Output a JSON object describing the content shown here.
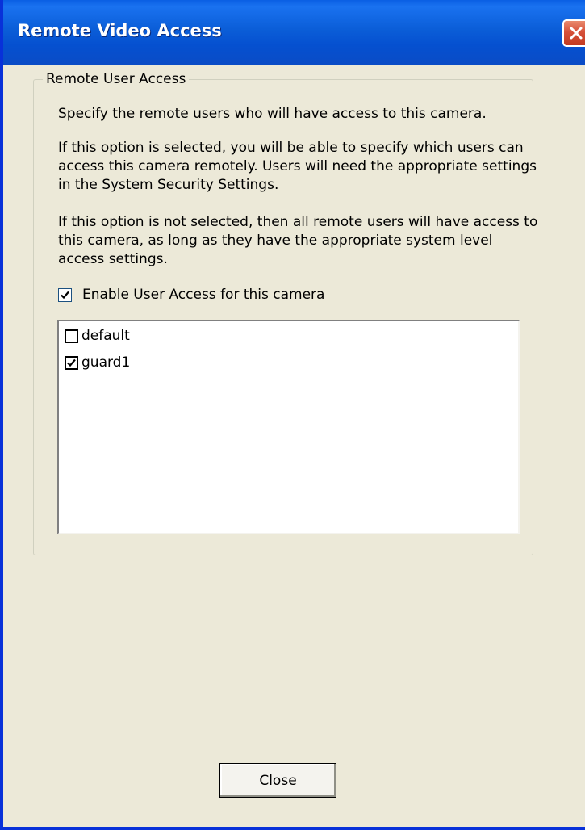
{
  "window": {
    "title": "Remote Video Access",
    "accent_color": "#0a5fe3",
    "close_icon": "close-icon"
  },
  "group": {
    "label": "Remote User Access",
    "intro": "Specify the remote users who will have access to this camera.",
    "selected_info": "If this option is selected, you will be able to specify which users can access this camera remotely. Users will need the appropriate settings in the System Security Settings.",
    "not_selected_info": "If this option is not selected, then all remote users will have access to this camera, as long as they have the appropriate system level access settings."
  },
  "enable_access": {
    "label": "Enable User Access for this camera",
    "checked": true
  },
  "users": [
    {
      "name": "default",
      "checked": false
    },
    {
      "name": "guard1",
      "checked": true
    }
  ],
  "buttons": {
    "close_label": "Close"
  }
}
